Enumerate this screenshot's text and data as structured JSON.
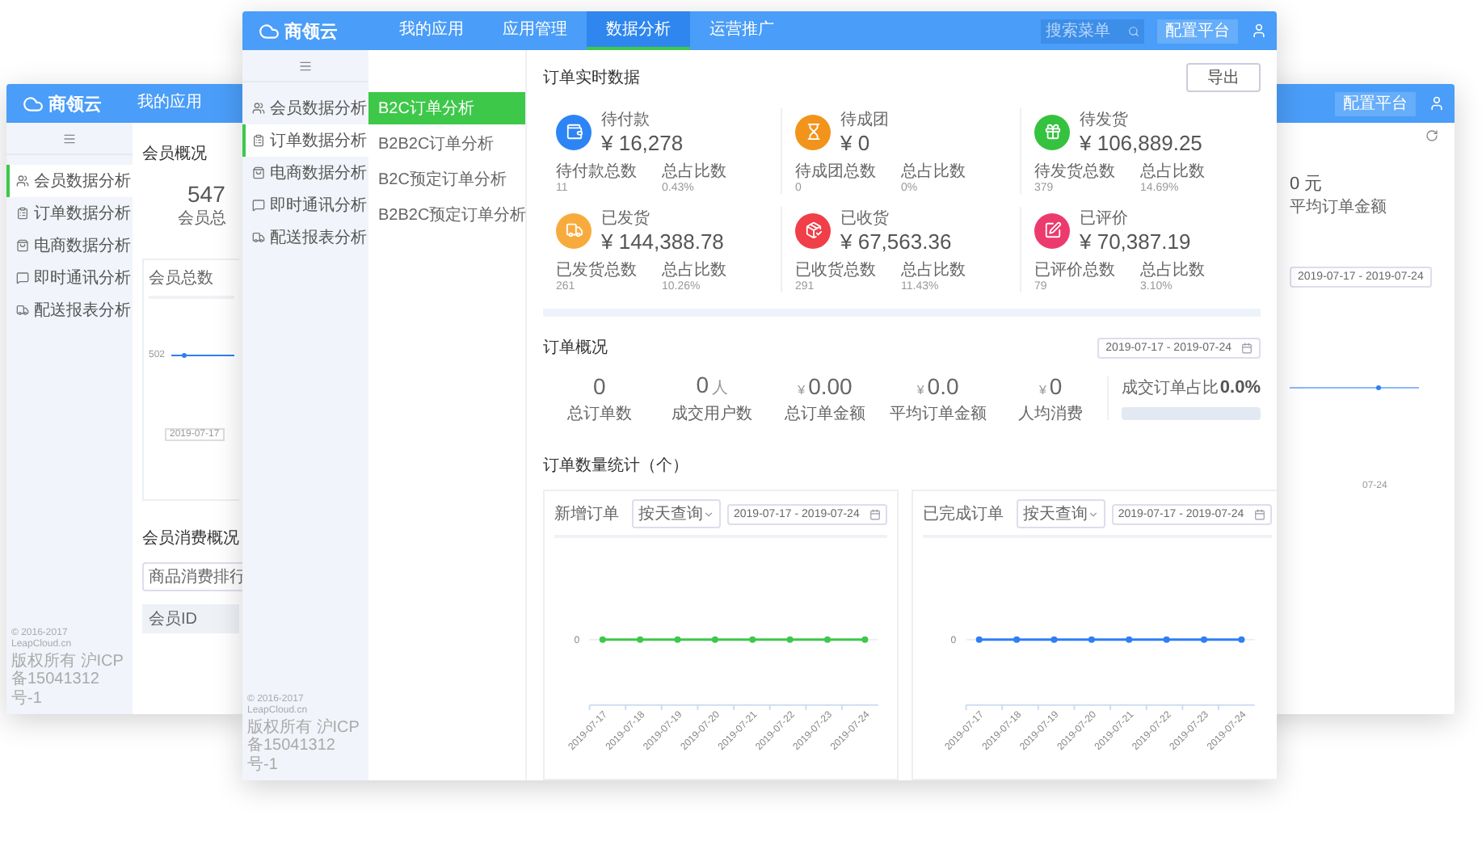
{
  "back_left_window": {
    "header": {
      "logo": "商领云",
      "nav": [
        {
          "label": "我的应用",
          "selected": false
        }
      ]
    },
    "sidebar": {
      "items": [
        {
          "label": "会员数据分析",
          "selected": true
        },
        {
          "label": "订单数据分析",
          "selected": false
        },
        {
          "label": "电商数据分析",
          "selected": false
        },
        {
          "label": "即时通讯分析",
          "selected": false
        },
        {
          "label": "配送报表分析",
          "selected": false
        }
      ],
      "footer": [
        "© 2016-2017 LeapCloud.cn",
        "版权所有 沪ICP备15041312号-1"
      ]
    },
    "overview": {
      "title": "会员概况",
      "total": "547",
      "total_label": "会员总"
    },
    "chart_card": {
      "title": "会员总数",
      "y_label": "502",
      "x_label": "2019-07-17"
    },
    "consumption": {
      "title": "会员消费概况",
      "select": "商品消费排行",
      "table_column": "会员ID"
    }
  },
  "back_right_window": {
    "config_button": "配置平台",
    "value": "0 元",
    "value_label": "平均订单金额",
    "date_range": "2019-07-17 - 2019-07-24",
    "x_label": "07-24"
  },
  "main_window": {
    "header": {
      "logo": "商领云",
      "nav": [
        {
          "label": "我的应用",
          "selected": false
        },
        {
          "label": "应用管理",
          "selected": false
        },
        {
          "label": "数据分析",
          "selected": true
        },
        {
          "label": "运营推广",
          "selected": false
        }
      ],
      "search": {
        "placeholder": "搜索菜单"
      },
      "config_button": "配置平台"
    },
    "sidebar": {
      "items": [
        {
          "label": "会员数据分析",
          "selected": false
        },
        {
          "label": "订单数据分析",
          "selected": true
        },
        {
          "label": "电商数据分析",
          "selected": false
        },
        {
          "label": "即时通讯分析",
          "selected": false
        },
        {
          "label": "配送报表分析",
          "selected": false
        }
      ],
      "footer": [
        "© 2016-2017 LeapCloud.cn",
        "版权所有 沪ICP备15041312号-1"
      ]
    },
    "submenu": {
      "items": [
        {
          "label": "B2C订单分析",
          "selected": true
        },
        {
          "label": "B2B2C订单分析",
          "selected": false
        },
        {
          "label": "B2C预定订单分析",
          "selected": false
        },
        {
          "label": "B2B2C预定订单分析",
          "selected": false
        }
      ]
    },
    "realtime": {
      "title": "订单实时数据",
      "export_button": "导出",
      "cards": [
        {
          "label": "待付款",
          "value": "¥ 16,278",
          "color": "#2d84f5",
          "count_label": "待付款总数",
          "count": "11",
          "ratio_label": "总占比数",
          "ratio": "0.43%"
        },
        {
          "label": "待成团",
          "value": "¥ 0",
          "color": "#f2941c",
          "count_label": "待成团总数",
          "count": "0",
          "ratio_label": "总占比数",
          "ratio": "0%"
        },
        {
          "label": "待发货",
          "value": "¥ 106,889.25",
          "color": "#35c23f",
          "count_label": "待发货总数",
          "count": "379",
          "ratio_label": "总占比数",
          "ratio": "14.69%"
        },
        {
          "label": "已发货",
          "value": "¥ 144,388.78",
          "color": "#f8ab3d",
          "count_label": "已发货总数",
          "count": "261",
          "ratio_label": "总占比数",
          "ratio": "10.26%"
        },
        {
          "label": "已收货",
          "value": "¥ 67,563.36",
          "color": "#f03f48",
          "count_label": "已收货总数",
          "count": "291",
          "ratio_label": "总占比数",
          "ratio": "11.43%"
        },
        {
          "label": "已评价",
          "value": "¥ 70,387.19",
          "color": "#ec3a6c",
          "count_label": "已评价总数",
          "count": "79",
          "ratio_label": "总占比数",
          "ratio": "3.10%"
        }
      ]
    },
    "overview": {
      "title": "订单概况",
      "date_range": "2019-07-17 - 2019-07-24",
      "stats": [
        {
          "value": "0",
          "label": "总订单数"
        },
        {
          "value": "0",
          "unit": "人",
          "label": "成交用户数"
        },
        {
          "currency": "¥",
          "value": "0.00",
          "label": "总订单金额"
        },
        {
          "currency": "¥",
          "value": "0.0",
          "label": "平均订单金额"
        },
        {
          "currency": "¥",
          "value": "0",
          "label": "人均消费"
        }
      ],
      "ratio": {
        "label": "成交订单占比",
        "value": "0.0%",
        "level": 0
      }
    },
    "counts": {
      "title": "订单数量统计（个）",
      "charts": [
        {
          "title": "新增订单",
          "period": "按天查询",
          "date_range": "2019-07-17 - 2019-07-24",
          "y_label": "0",
          "color": "#3ec84a",
          "x_labels": [
            "2019-07-17",
            "2019-07-18",
            "2019-07-19",
            "2019-07-20",
            "2019-07-21",
            "2019-07-22",
            "2019-07-23",
            "2019-07-24"
          ]
        },
        {
          "title": "已完成订单",
          "period": "按天查询",
          "date_range": "2019-07-17 - 2019-07-24",
          "y_label": "0",
          "color": "#2f7ef5",
          "x_labels": [
            "2019-07-17",
            "2019-07-18",
            "2019-07-19",
            "2019-07-20",
            "2019-07-21",
            "2019-07-22",
            "2019-07-23",
            "2019-07-24"
          ]
        }
      ]
    }
  }
}
